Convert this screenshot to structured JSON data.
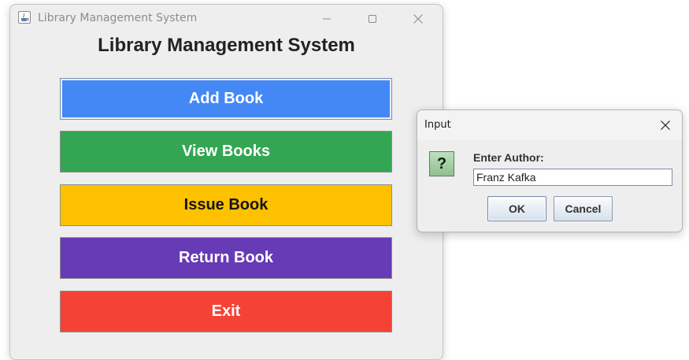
{
  "main_window": {
    "title": "Library Management System",
    "heading": "Library Management System",
    "buttons": [
      {
        "label": "Add Book",
        "color": "#4488f5"
      },
      {
        "label": "View Books",
        "color": "#33a654"
      },
      {
        "label": "Issue Book",
        "color": "#fdc100"
      },
      {
        "label": "Return Book",
        "color": "#673ab6"
      },
      {
        "label": "Exit",
        "color": "#f44336"
      }
    ],
    "controls": [
      "minimize-icon",
      "maximize-icon",
      "close-icon"
    ]
  },
  "dialog": {
    "title": "Input",
    "prompt": "Enter Author:",
    "input_value": "Franz Kafka",
    "icon": "question-icon",
    "ok_label": "OK",
    "cancel_label": "Cancel"
  }
}
